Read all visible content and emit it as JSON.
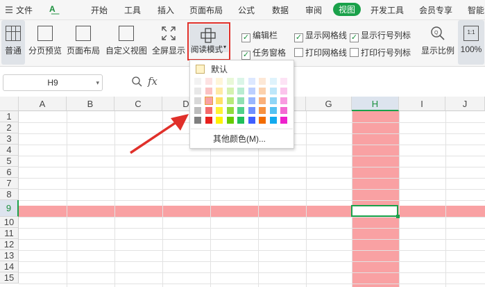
{
  "menubar": {
    "file_label": "文件",
    "tabs": [
      "开始",
      "工具",
      "插入",
      "页面布局",
      "公式",
      "数据",
      "审阅",
      "视图",
      "开发工具",
      "会员专享",
      "智能"
    ],
    "active_tab": "视图"
  },
  "ribbon": {
    "normal": "普通",
    "page_break": "分页预览",
    "page_layout": "页面布局",
    "custom_view": "自定义视图",
    "fullscreen": "全屏显示",
    "reading_mode": "阅读模式",
    "formula_bar": "编辑栏",
    "task_pane": "任务窗格",
    "show_gridlines": "显示网格线",
    "print_gridlines": "打印网格线",
    "show_headers": "显示行号列标",
    "print_headers": "打印行号列标",
    "zoom": "显示比例",
    "zoom_100": "100%"
  },
  "formula_bar": {
    "name_box": "H9",
    "fx": "fx"
  },
  "popup": {
    "default_label": "默认",
    "more_colors": "其他颜色(M)..."
  },
  "grid": {
    "columns": [
      "A",
      "B",
      "C",
      "D",
      "E",
      "F",
      "G",
      "H",
      "I",
      "J"
    ],
    "rows": [
      "1",
      "2",
      "3",
      "4",
      "5",
      "6",
      "7",
      "8",
      "9",
      "10",
      "11",
      "12",
      "13",
      "14",
      "15"
    ],
    "selected_cell": "H9",
    "highlight_color": "#f9a1a3"
  },
  "colors": {
    "accent": "#1aa14a",
    "highlight": "#f9a1a3",
    "red_box": "#e0302a"
  }
}
